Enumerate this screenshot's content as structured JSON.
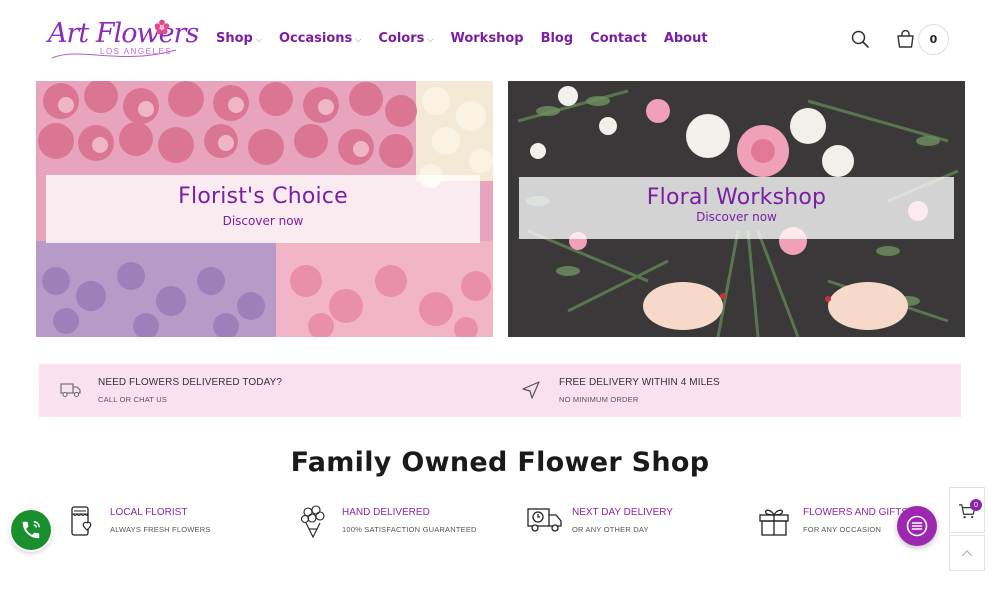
{
  "brand": {
    "logo_text": "Art Flowers",
    "logo_sub": "LOS ANGELES",
    "primary_color": "#7b1fa2",
    "accent_pink": "#fae1ef"
  },
  "nav": {
    "items": [
      {
        "label": "Shop",
        "has_dropdown": true
      },
      {
        "label": "Occasions",
        "has_dropdown": true
      },
      {
        "label": "Colors",
        "has_dropdown": true
      },
      {
        "label": "Workshop",
        "has_dropdown": false
      },
      {
        "label": "Blog",
        "has_dropdown": false
      },
      {
        "label": "Contact",
        "has_dropdown": false
      },
      {
        "label": "About",
        "has_dropdown": false
      }
    ],
    "caret": "⌵"
  },
  "header_icons": {
    "search": "search-icon",
    "cart": "shopping-bag-icon",
    "cart_count": "0"
  },
  "banners": [
    {
      "title": "Florist's Choice",
      "link": "Discover now"
    },
    {
      "title": "Floral Workshop",
      "link": "Discover now"
    }
  ],
  "info_strip": [
    {
      "icon": "delivery-truck-icon",
      "title": "NEED FLOWERS DELIVERED TODAY?",
      "subtitle": "CALL OR CHAT US"
    },
    {
      "icon": "navigation-arrow-icon",
      "title": "FREE DELIVERY WITHIN 4 MILES",
      "subtitle": "NO MINIMUM ORDER"
    }
  ],
  "section": {
    "heading": "Family Owned Flower Shop"
  },
  "features": [
    {
      "icon": "shop-phone-icon",
      "title": "LOCAL FLORIST",
      "subtitle": "ALWAYS FRESH FLOWERS"
    },
    {
      "icon": "bouquet-icon",
      "title": "HAND DELIVERED",
      "subtitle": "100% SATISFACTION GUARANTEED"
    },
    {
      "icon": "delivery-truck-clock-icon",
      "title": "NEXT DAY DELIVERY",
      "subtitle": "OR ANY OTHER DAY"
    },
    {
      "icon": "gift-icon",
      "title": "FLOWERS AND GIFTS",
      "subtitle": "FOR ANY OCCASION"
    }
  ],
  "widgets": {
    "phone": "phone-icon",
    "chat": "chat-menu-icon",
    "side_cart_count": "0",
    "back_to_top": "chevron-up-icon"
  }
}
